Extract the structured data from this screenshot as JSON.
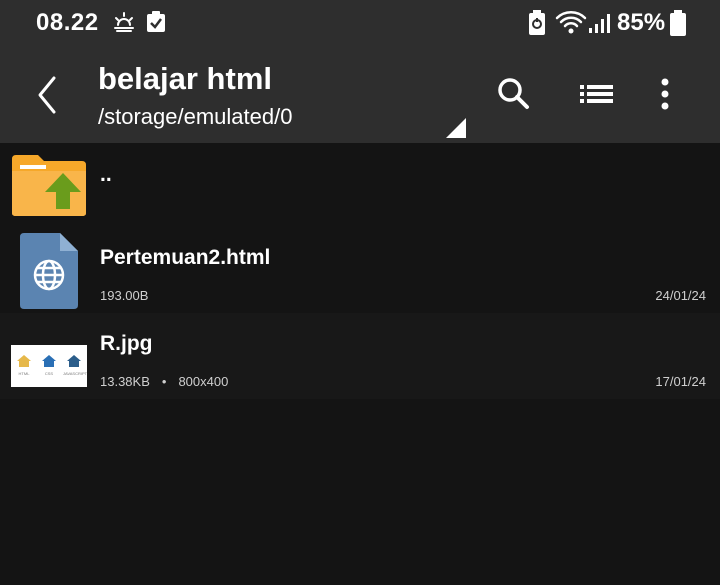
{
  "status_bar": {
    "time": "08.22",
    "battery_percent": "85%",
    "icons": [
      "weather-sunrise-icon",
      "check-square-icon",
      "battery-saver-icon",
      "wifi-icon",
      "signal-icon",
      "battery-icon"
    ]
  },
  "toolbar": {
    "title": "belajar html",
    "path": "/storage/emulated/0",
    "actions": [
      "back-icon",
      "search-icon",
      "list-view-icon",
      "more-vert-icon"
    ]
  },
  "files": [
    {
      "name": "..",
      "icon": "folder-up-icon",
      "size": "",
      "resolution": "",
      "date": ""
    },
    {
      "name": "Pertemuan2.html",
      "icon": "html-file-icon",
      "size": "193.00B",
      "resolution": "",
      "date": "24/01/24"
    },
    {
      "name": "R.jpg",
      "icon": "image-thumbnail",
      "size": "13.38KB",
      "resolution": "800x400",
      "date": "17/01/24",
      "dot": "•"
    }
  ],
  "thumbnail": {
    "labels": [
      "HTML",
      "CSS",
      "JAVASCRIPT"
    ]
  },
  "colors": {
    "background": "#141414",
    "bar_background": "#2e2e2e",
    "folder": "#f6a82a",
    "up_arrow": "#6a9c1c",
    "html_file": "#5b84b1"
  }
}
